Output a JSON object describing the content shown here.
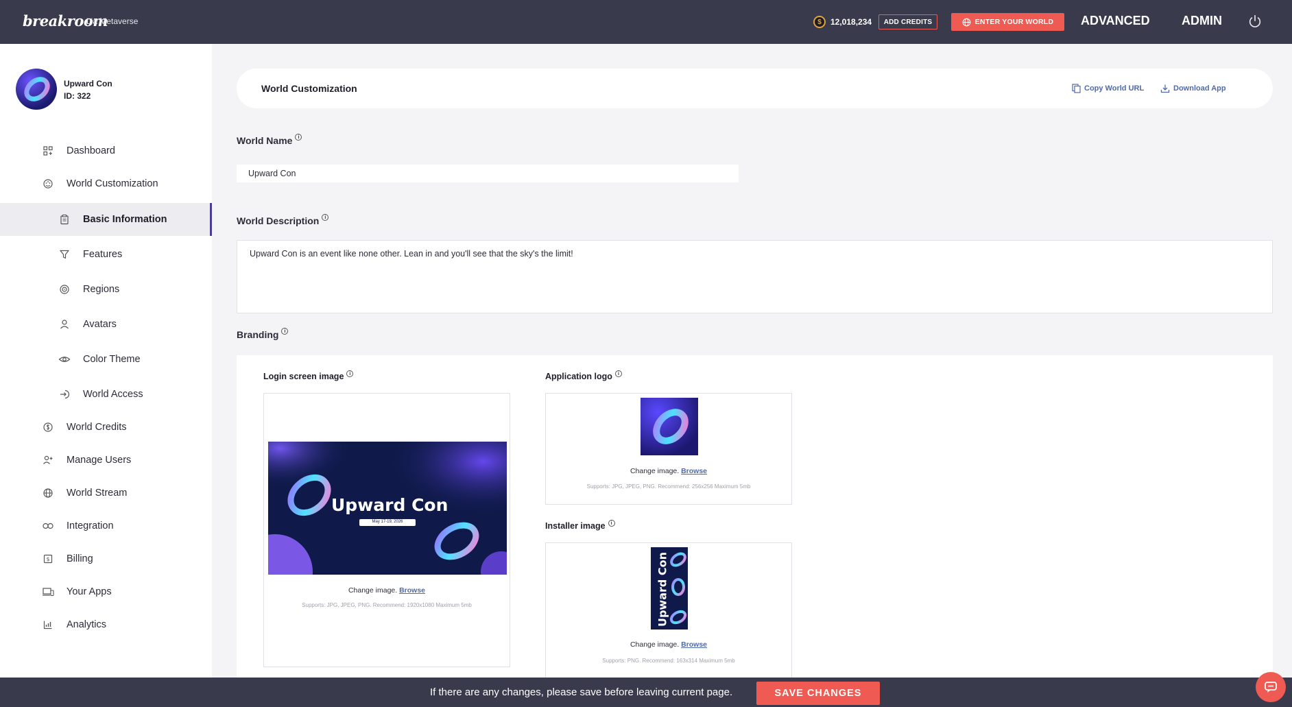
{
  "topbar": {
    "logo": "breakroom",
    "world_name": "Lia Metaverse",
    "credits": "12,018,234",
    "add_credits": "ADD CREDITS",
    "enter_world": "ENTER YOUR WORLD",
    "advanced": "ADVANCED",
    "admin": "ADMIN",
    "accent_color": "#ef5a52",
    "bar_color": "#393a4c"
  },
  "profile": {
    "name": "Upward Con",
    "id": "ID: 322"
  },
  "sidebar": {
    "items": [
      {
        "label": "Dashboard",
        "icon": "dashboard-icon"
      },
      {
        "label": "World Customization",
        "icon": "palette-icon"
      },
      {
        "label": "Basic Information",
        "icon": "clipboard-icon",
        "active": true
      },
      {
        "label": "Features",
        "icon": "filter-icon"
      },
      {
        "label": "Regions",
        "icon": "regions-icon"
      },
      {
        "label": "Avatars",
        "icon": "user-icon"
      },
      {
        "label": "Color Theme",
        "icon": "eye-icon"
      },
      {
        "label": "World Access",
        "icon": "login-icon"
      },
      {
        "label": "World Credits",
        "icon": "coin-icon"
      },
      {
        "label": "Manage Users",
        "icon": "add-user-icon"
      },
      {
        "label": "World Stream",
        "icon": "globe-icon"
      },
      {
        "label": "Integration",
        "icon": "link-icon"
      },
      {
        "label": "Billing",
        "icon": "billing-icon"
      },
      {
        "label": "Your Apps",
        "icon": "devices-icon"
      },
      {
        "label": "Analytics",
        "icon": "analytics-icon"
      }
    ]
  },
  "header": {
    "title": "World Customization",
    "copy_url": "Copy World URL",
    "download_app": "Download App"
  },
  "form": {
    "world_name_label": "World Name",
    "world_name_value": "Upward Con",
    "world_desc_label": "World Description",
    "world_desc_value": "Upward Con is an event like none other. Lean in and you'll see that the sky's the limit!",
    "branding_label": "Branding"
  },
  "branding": {
    "login": {
      "label": "Login screen image",
      "banner_title": "Upward Con",
      "banner_date": "May 17-19, 2026",
      "change": "Change image.",
      "browse": "Browse",
      "supports": "Supports: JPG, JPEG, PNG. Recommend: 1920x1080 Maximum 5mb"
    },
    "logo": {
      "label": "Application logo",
      "change": "Change image.",
      "browse": "Browse",
      "supports": "Supports: JPG, JPEG, PNG. Recommend: 256x256 Maximum 5mb"
    },
    "installer": {
      "label": "Installer image",
      "vertical_text": "Upward Con",
      "change": "Change image.",
      "browse": "Browse",
      "supports": "Supports: PNG. Recommend: 163x314 Maximum 5mb"
    }
  },
  "footer": {
    "message": "If there are any changes, please save before leaving current page.",
    "save": "SAVE CHANGES"
  }
}
